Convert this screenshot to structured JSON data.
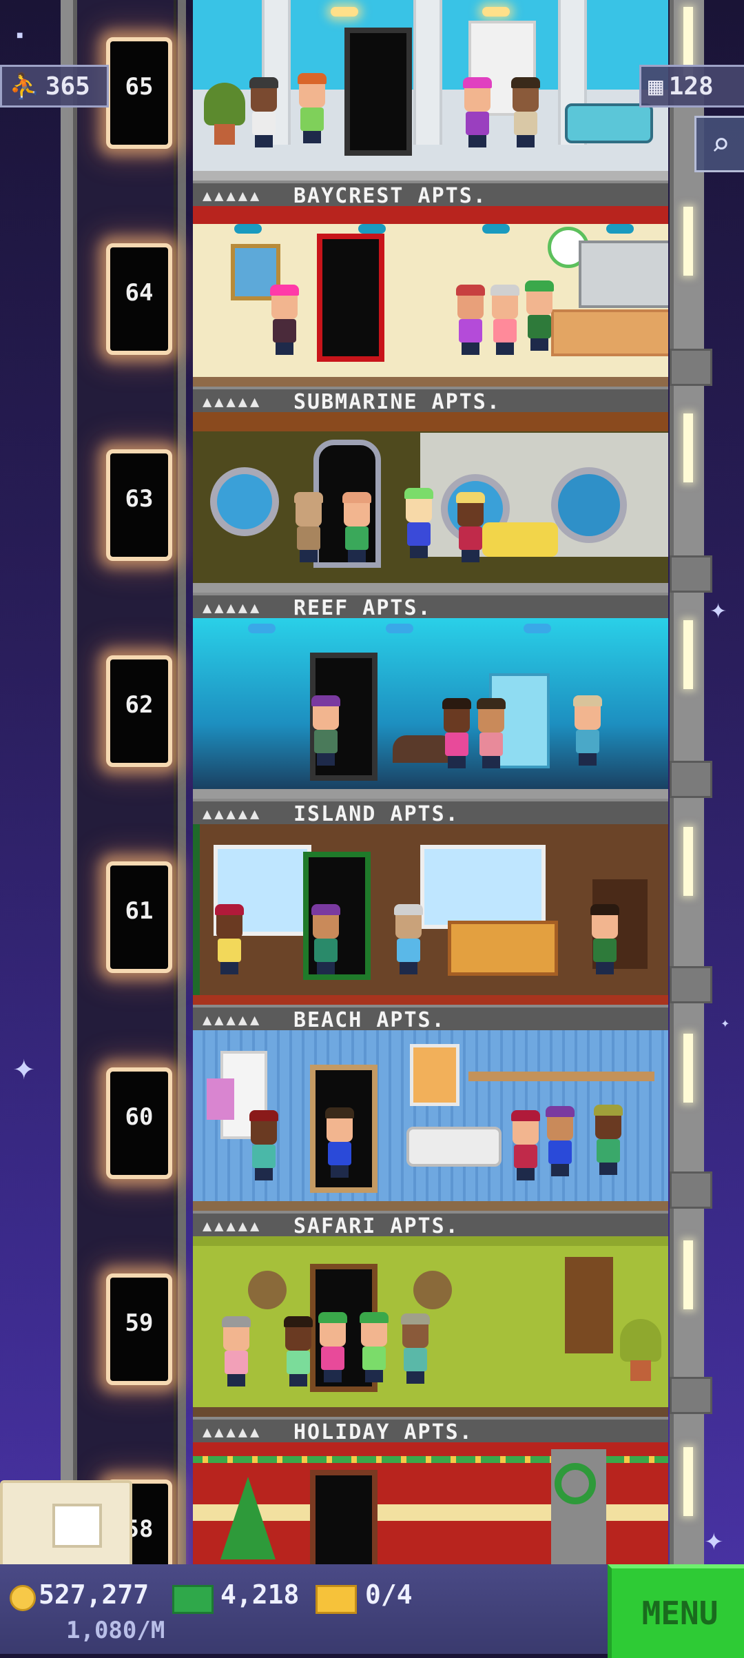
{
  "hud": {
    "population": "365",
    "floors": "128",
    "coins": "527,277",
    "income": "1,080/M",
    "bux": "4,218",
    "tickets": "0/4",
    "menu_label": "MENU"
  },
  "elevator": {
    "floor_numbers": [
      "65",
      "64",
      "63",
      "62",
      "61",
      "60",
      "59",
      "58"
    ]
  },
  "floors": [
    {
      "number": "65",
      "sign": "BAYCREST APTS.",
      "slots": "▲▲▲▲▲",
      "theme": "baycrest"
    },
    {
      "number": "64",
      "sign": "SUBMARINE APTS.",
      "slots": "▲▲▲▲▲",
      "theme": "submarine"
    },
    {
      "number": "63",
      "sign": "REEF APTS.",
      "slots": "▲▲▲▲▲",
      "theme": "reef"
    },
    {
      "number": "62",
      "sign": "ISLAND APTS.",
      "slots": "▲▲▲▲▲",
      "theme": "island"
    },
    {
      "number": "61",
      "sign": "BEACH APTS.",
      "slots": "▲▲▲▲▲",
      "theme": "beach"
    },
    {
      "number": "60",
      "sign": "SAFARI APTS.",
      "slots": "▲▲▲▲▲",
      "theme": "safari"
    },
    {
      "number": "59",
      "sign": "HOLIDAY APTS.",
      "slots": "▲▲▲▲▲",
      "theme": "holiday"
    }
  ],
  "colors": {
    "menu_green": "#2ecb35",
    "hud_panel": "#4a4a86",
    "sky": "#2a1e5c"
  },
  "icons": [
    "person-icon",
    "building-icon",
    "search-icon",
    "coin-icon",
    "bux-icon",
    "ticket-icon",
    "stash-box-icon"
  ]
}
